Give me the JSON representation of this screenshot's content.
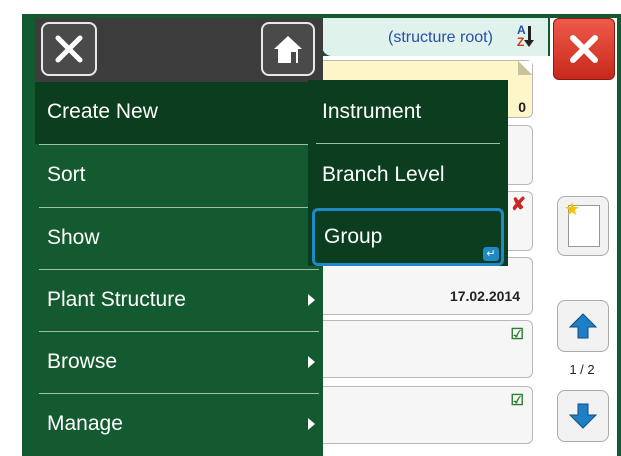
{
  "header": {
    "title": "(structure root)",
    "sort_icon": "sort-az-icon"
  },
  "menu": {
    "close_icon": "close-icon",
    "home_icon": "home-icon",
    "items": [
      {
        "label": "Create New",
        "has_submenu": false,
        "selected": true
      },
      {
        "label": "Sort",
        "has_submenu": false
      },
      {
        "label": "Show",
        "has_submenu": false
      },
      {
        "label": "Plant Structure",
        "has_submenu": true
      },
      {
        "label": "Browse",
        "has_submenu": true
      },
      {
        "label": "Manage",
        "has_submenu": true
      }
    ]
  },
  "submenu": {
    "items": [
      {
        "label": "Instrument"
      },
      {
        "label": "Branch Level"
      },
      {
        "label": "Group",
        "selected": true
      }
    ]
  },
  "list": {
    "card1_count": "0",
    "card4_date": "17.02.2014"
  },
  "sidebar": {
    "page_indicator": "1 / 2"
  },
  "colors": {
    "menu_green": "#145a30",
    "menu_dark_green": "#0b3d1f",
    "selection_blue": "#1f88c6",
    "close_red": "#d9372a"
  }
}
